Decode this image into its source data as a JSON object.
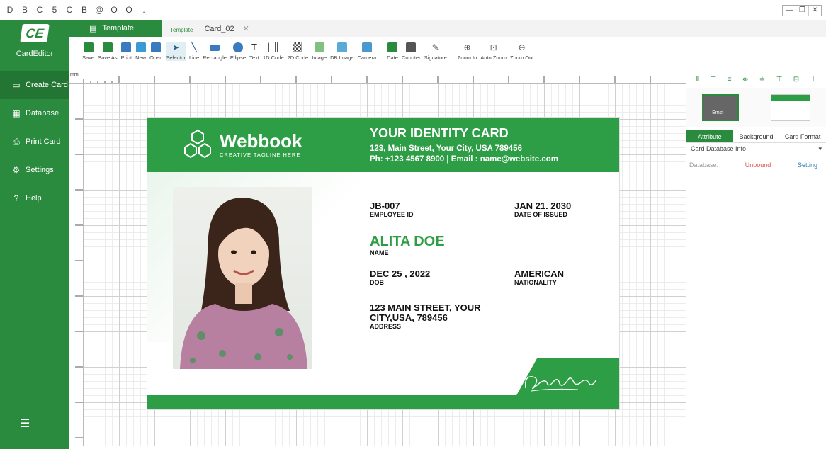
{
  "app": {
    "logo": "CE",
    "name": "CardEditor"
  },
  "quick_toolbar": [
    "D",
    "B",
    "C",
    "5",
    "C",
    "B",
    "@",
    "O",
    "O",
    "."
  ],
  "sidebar": {
    "items": [
      {
        "label": "Create Card",
        "icon": "card-icon"
      },
      {
        "label": "Database",
        "icon": "database-icon"
      },
      {
        "label": "Print Card",
        "icon": "printer-icon"
      },
      {
        "label": "Settings",
        "icon": "gear-icon"
      },
      {
        "label": "Help",
        "icon": "help-icon"
      }
    ]
  },
  "tabs": {
    "template": "Template",
    "sub": "Template",
    "card": "Card_02",
    "close": "✕"
  },
  "toolbar": [
    "Save",
    "Save As",
    "Print",
    "New",
    "Open",
    "Selector",
    "Line",
    "Rectangle",
    "Ellipse",
    "Text",
    "1D Code",
    "2D Code",
    "Image",
    "DB Image",
    "Camera",
    "Date",
    "Counter",
    "Signature",
    "Zoom In",
    "Auto Zoom",
    "Zoom Out"
  ],
  "ruler": {
    "unit": "mm"
  },
  "card": {
    "brand": "Webbook",
    "tagline": "CREATIVE TAGLINE HERE",
    "title": "YOUR IDENTITY CARD",
    "address_line": "123, Main Street, Your City,  USA 789456",
    "contact_line": "Ph: +123 4567 8900  | Email : name@website.com",
    "employee_id": {
      "value": "JB-007",
      "label": "EMPLOYEE ID"
    },
    "date_issued": {
      "value": "JAN 21. 2030",
      "label": "DATE OF ISSUED"
    },
    "name": {
      "value": "ALITA DOE",
      "label": "NAME"
    },
    "dob": {
      "value": "DEC 25 , 2022",
      "label": "DOB"
    },
    "nationality": {
      "value": "AMERICAN",
      "label": "NATIONALITY"
    },
    "address": {
      "value1": "123 MAIN STREET, YOUR",
      "value2": "CITY,USA, 789456",
      "label": "ADDRESS"
    }
  },
  "right_panel": {
    "thumb1_text": "Emst",
    "tabs": [
      "Attribute",
      "Background",
      "Card Format"
    ],
    "db_info": "Card Database Info",
    "database_label": "Database:",
    "database_status": "Unbound",
    "setting_link": "Setting"
  },
  "colors": {
    "primary": "#2a8a3e",
    "card_green": "#2e9e46"
  }
}
